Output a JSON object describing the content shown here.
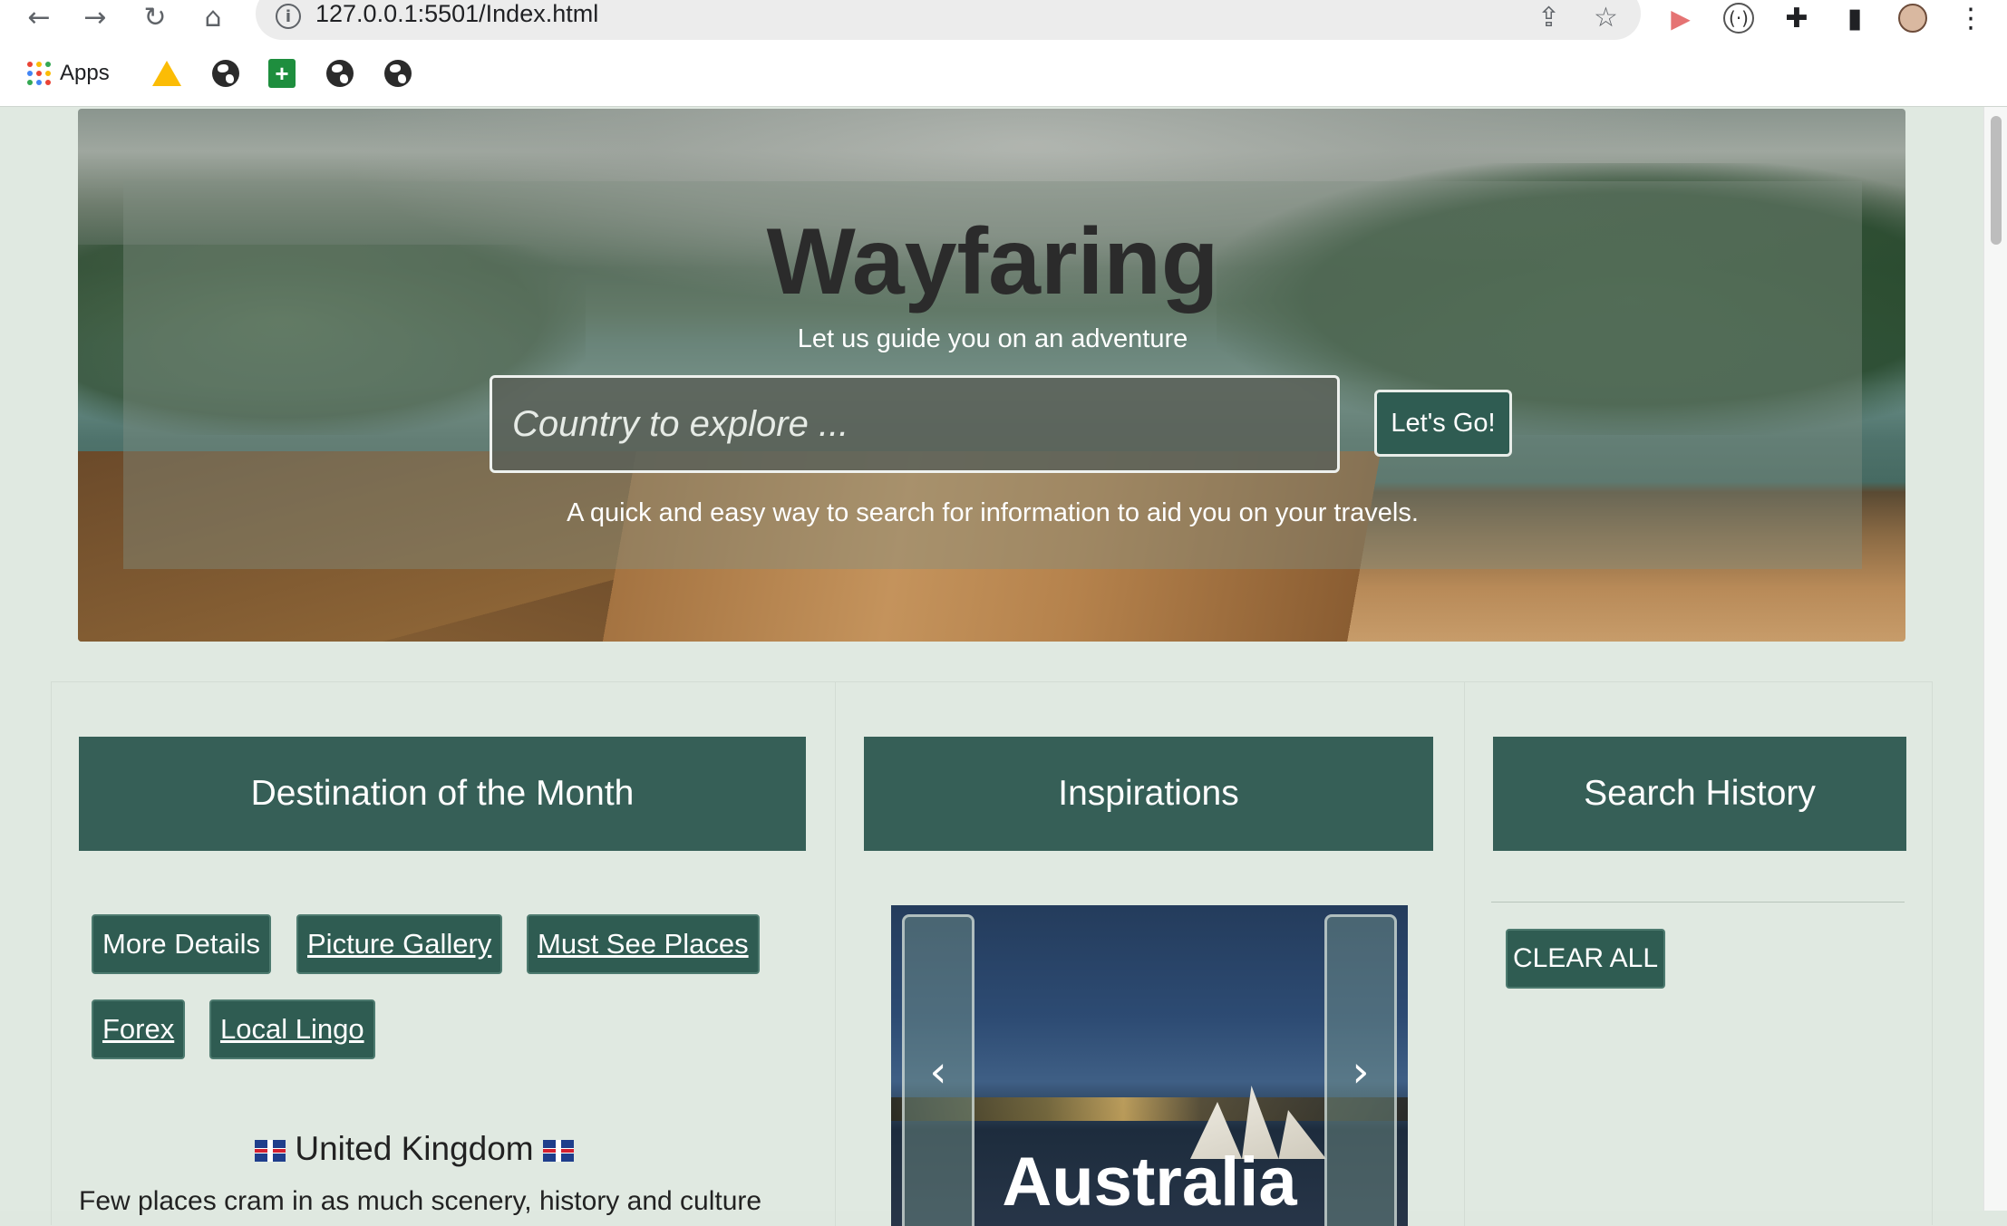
{
  "browser": {
    "url": "127.0.0.1:5501/Index.html",
    "bookmarks": {
      "apps_label": "Apps"
    }
  },
  "hero": {
    "title": "Wayfaring",
    "subtitle": "Let us guide you on an adventure",
    "search_placeholder": "Country to explore ...",
    "search_button": "Let's Go!",
    "description": "A quick and easy way to search for information to aid you on your travels."
  },
  "destination": {
    "heading": "Destination of the Month",
    "buttons": [
      "More Details",
      "Picture Gallery",
      "Must See Places",
      "Forex",
      "Local Lingo"
    ],
    "country": "United Kingdom",
    "description": "Few places cram in as much scenery, history and culture"
  },
  "inspirations": {
    "heading": "Inspirations",
    "slide_caption": "Australia"
  },
  "history": {
    "heading": "Search History",
    "clear_button": "CLEAR ALL"
  },
  "colors": {
    "accent": "#365f57",
    "page_bg": "#e0e9e1"
  }
}
